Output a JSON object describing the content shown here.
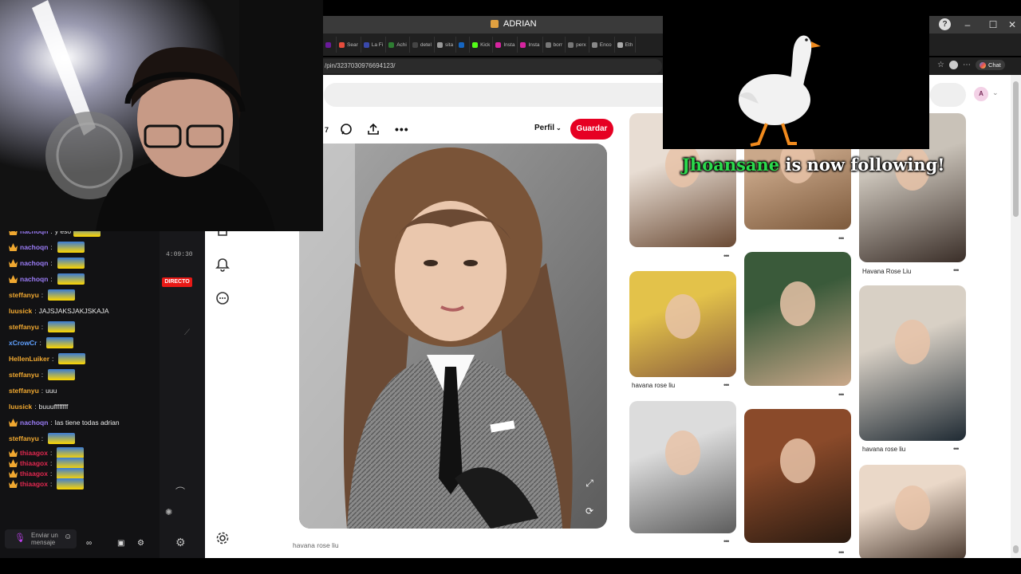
{
  "browser": {
    "window_title": "ADRIAN",
    "address": "/pin/3237030976694123/",
    "chat_button": "Chat",
    "tabs": [
      {
        "label": "",
        "color": "#6a1b9a"
      },
      {
        "label": "Sear",
        "color": "#e74c3c"
      },
      {
        "label": "La Fi",
        "color": "#3949ab"
      },
      {
        "label": "Achi",
        "color": "#2e7d32"
      },
      {
        "label": "detel",
        "color": "#444"
      },
      {
        "label": "sita",
        "color": "#999"
      },
      {
        "label": "",
        "color": "#1565c0"
      },
      {
        "label": "Kick",
        "color": "#53fc18"
      },
      {
        "label": "Insta",
        "color": "#d6249f"
      },
      {
        "label": "Insta",
        "color": "#d6249f"
      },
      {
        "label": "borr",
        "color": "#777"
      },
      {
        "label": "perx",
        "color": "#777"
      },
      {
        "label": "Enco",
        "color": "#888"
      },
      {
        "label": "Eth",
        "color": "#aaa"
      }
    ]
  },
  "pinterest": {
    "avatar_initial": "A",
    "count": "7",
    "profile_label": "Perfil",
    "save_label": "Guardar",
    "main_caption": "havana rose liu",
    "thumbs": [
      {
        "label": ""
      },
      {
        "label": ""
      },
      {
        "label": "Havana Rose Liu"
      },
      {
        "label": "havana rose liu"
      },
      {
        "label": ""
      },
      {
        "label": "havana rose liu"
      },
      {
        "label": ""
      },
      {
        "label": ""
      },
      {
        "label": ""
      }
    ]
  },
  "alert": {
    "user": "Jhoansane",
    "text": " is now following!"
  },
  "stream": {
    "uptime": "4:09:30",
    "live_label": "DIRECTO",
    "input_placeholder": "Enviar un mensaje"
  },
  "chat": {
    "messages": [
      {
        "user": "nachoqn",
        "text": "y eso",
        "color": "#9b7cf7",
        "badge": true,
        "emote": true
      },
      {
        "user": "nachoqn",
        "text": "",
        "color": "#9b7cf7",
        "badge": true,
        "emote": true
      },
      {
        "user": "nachoqn",
        "text": "",
        "color": "#9b7cf7",
        "badge": true,
        "emote": true
      },
      {
        "user": "nachoqn",
        "text": "",
        "color": "#9b7cf7",
        "badge": true,
        "emote": true
      },
      {
        "user": "steffanyu",
        "text": "",
        "color": "#f0a830",
        "badge": false,
        "emote": true
      },
      {
        "user": "luusick",
        "text": "JAJSJAKSJAKJSKAJA",
        "color": "#f0a830",
        "badge": false,
        "emote": false
      },
      {
        "user": "steffanyu",
        "text": "",
        "color": "#f0a830",
        "badge": false,
        "emote": true
      },
      {
        "user": "xCrowCr",
        "text": "",
        "color": "#5fa0ff",
        "badge": false,
        "emote": true
      },
      {
        "user": "HellenLuiker",
        "text": "",
        "color": "#f0a830",
        "badge": false,
        "emote": true
      },
      {
        "user": "steffanyu",
        "text": "",
        "color": "#f0a830",
        "badge": false,
        "emote": true
      },
      {
        "user": "steffanyu",
        "text": "uuu",
        "color": "#f0a830",
        "badge": false,
        "emote": false
      },
      {
        "user": "luusick",
        "text": "buuuffffffff",
        "color": "#f0a830",
        "badge": false,
        "emote": false
      },
      {
        "user": "nachoqn",
        "text": "las tiene todas adrian",
        "color": "#9b7cf7",
        "badge": true,
        "emote": false
      },
      {
        "user": "steffanyu",
        "text": "",
        "color": "#f0a830",
        "badge": false,
        "emote": true
      },
      {
        "user": "thiaagox",
        "text": "",
        "color": "#e0284f",
        "badge": true,
        "emote": true
      },
      {
        "user": "thiaagox",
        "text": "",
        "color": "#e0284f",
        "badge": true,
        "emote": true
      },
      {
        "user": "thiaagox",
        "text": "",
        "color": "#e0284f",
        "badge": true,
        "emote": true
      },
      {
        "user": "thiaagox",
        "text": "",
        "color": "#e0284f",
        "badge": true,
        "emote": true
      }
    ]
  }
}
